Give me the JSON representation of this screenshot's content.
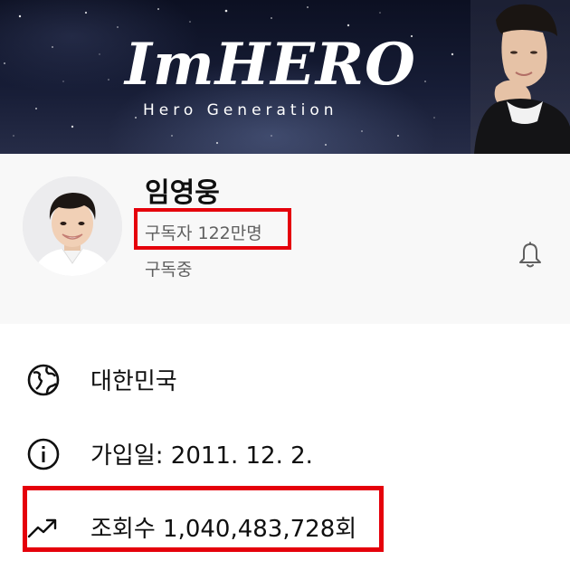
{
  "banner": {
    "logo_text": "ImHERO",
    "tagline": "Hero Generation"
  },
  "channel": {
    "name": "임영웅",
    "subscriber_count": "구독자 122만명",
    "subscription_status": "구독중",
    "notification_icon": "bell-icon"
  },
  "about": {
    "country": {
      "icon": "globe-icon",
      "text": "대한민국"
    },
    "joined": {
      "icon": "info-icon",
      "text": "가입일: 2011. 12. 2."
    },
    "views": {
      "icon": "trending-up-icon",
      "text": "조회수 1,040,483,728회"
    }
  },
  "colors": {
    "highlight": "#e5000b",
    "secondary_text": "#606060",
    "header_bg": "#f8f8f8"
  }
}
